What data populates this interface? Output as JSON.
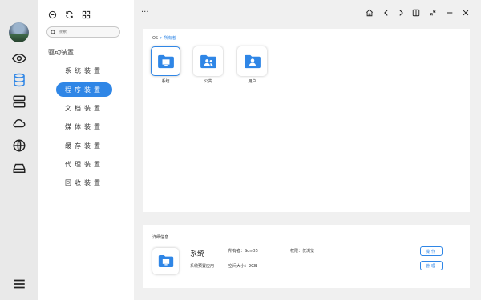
{
  "toolbar": {
    "more_label": "···"
  },
  "search": {
    "placeholder": "搜索"
  },
  "sidebar": {
    "section_title": "驱动装置",
    "items": [
      {
        "label": "系统装置",
        "active": false
      },
      {
        "label": "程序装置",
        "active": true
      },
      {
        "label": "文档装置",
        "active": false
      },
      {
        "label": "媒体装置",
        "active": false
      },
      {
        "label": "缓存装置",
        "active": false
      },
      {
        "label": "代理装置",
        "active": false
      },
      {
        "label": "回收装置",
        "active": false
      }
    ]
  },
  "breadcrumb": {
    "root": "OS",
    "separator": ">",
    "current": "所有者"
  },
  "folders": [
    {
      "name": "系统",
      "icon": "monitor-folder-icon",
      "selected": true
    },
    {
      "name": "公共",
      "icon": "users-folder-icon",
      "selected": false
    },
    {
      "name": "用户",
      "icon": "user-folder-icon",
      "selected": false
    }
  ],
  "details": {
    "title": "详细信息",
    "name": "系统",
    "subtitle": "系统预置应用",
    "owner": "所有者：SunOS",
    "permission": "权限：仅浏览",
    "size": "空间大小：2GB",
    "button_primary": "操作",
    "button_secondary": "管理"
  },
  "colors": {
    "accent": "#2f86e6",
    "rail_bg": "#e9e9e9",
    "page_bg": "#f0f0f0"
  }
}
